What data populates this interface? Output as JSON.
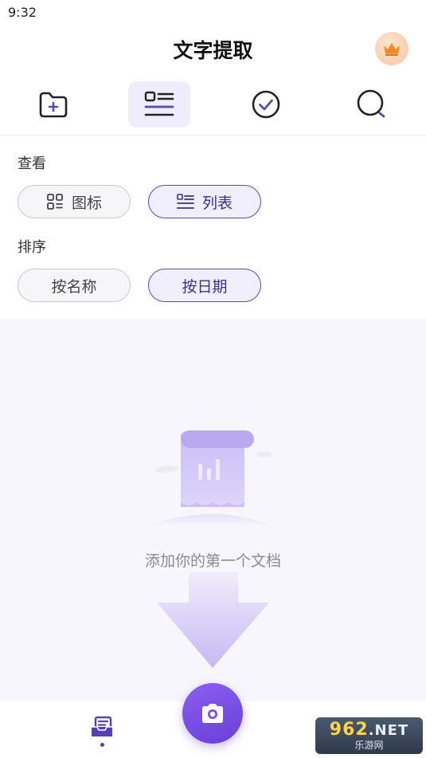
{
  "status": {
    "time": "9:32"
  },
  "header": {
    "title": "文字提取"
  },
  "toolbar": {
    "items": [
      {
        "icon": "new-folder-icon",
        "active": false
      },
      {
        "icon": "list-view-icon",
        "active": true
      },
      {
        "icon": "select-check-icon",
        "active": false
      },
      {
        "icon": "search-icon",
        "active": false
      }
    ]
  },
  "view_section": {
    "label": "查看",
    "options": [
      {
        "label": "图标",
        "icon": "grid-icon",
        "selected": false
      },
      {
        "label": "列表",
        "icon": "list-icon",
        "selected": true
      }
    ]
  },
  "sort_section": {
    "label": "排序",
    "options": [
      {
        "label": "按名称",
        "selected": false
      },
      {
        "label": "按日期",
        "selected": true
      }
    ]
  },
  "empty_state": {
    "text": "添加你的第一个文档"
  },
  "bottom_nav": {
    "docs_icon": "documents-icon",
    "camera_icon": "camera-icon"
  },
  "watermark": {
    "main": "962",
    "net": ".NET",
    "sub": "乐游网"
  },
  "colors": {
    "accent": "#5b4bb0",
    "camera": "#7a4ee6",
    "empty_text": "#8a8a96"
  }
}
